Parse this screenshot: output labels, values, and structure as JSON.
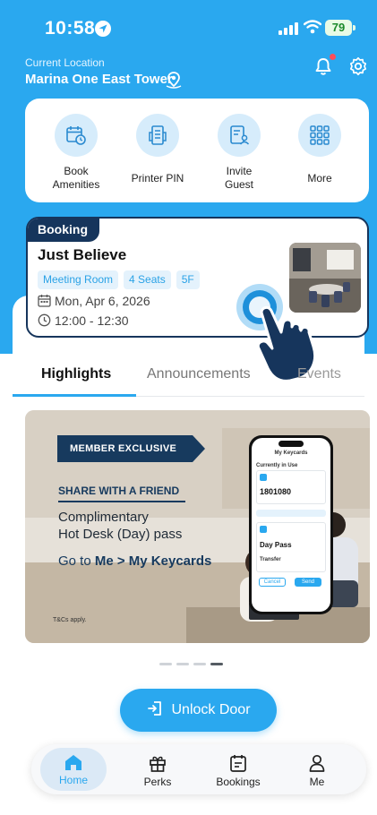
{
  "status_bar": {
    "time": "10:58",
    "battery": "79"
  },
  "header": {
    "location_label": "Current Location",
    "location_name": "Marina One East Tower"
  },
  "quick_actions": [
    {
      "label": "Book\nAmenities",
      "icon": "calendar-clock-icon"
    },
    {
      "label": "Printer PIN",
      "icon": "printer-icon"
    },
    {
      "label": "Invite\nGuest",
      "icon": "guest-badge-icon"
    },
    {
      "label": "More",
      "icon": "grid-icon"
    }
  ],
  "booking": {
    "tag": "Booking",
    "title": "Just Believe",
    "chips": [
      "Meeting Room",
      "4 Seats",
      "5F"
    ],
    "date": "Mon, Apr 6, 2026",
    "time": "12:00 - 12:30"
  },
  "tabs": {
    "highlights": "Highlights",
    "announcements": "Announcements",
    "events": "Events"
  },
  "banner": {
    "tag": "MEMBER EXCLUSIVE",
    "headline": "SHARE WITH A FRIEND",
    "line1": "Complimentary",
    "line2": "Hot Desk (Day) pass",
    "goto_prefix": "Go to ",
    "goto_path": "Me > My Keycards",
    "terms": "T&Cs apply.",
    "phone": {
      "title": "My Keycards",
      "section": "Currently in Use",
      "code": "1801080",
      "pass_title": "Day Pass",
      "transfer": "Transfer",
      "cancel": "Cancel",
      "send": "Send"
    }
  },
  "carousel": {
    "count": 4,
    "active_index": 3
  },
  "unlock_label": "Unlock Door",
  "nav": {
    "home": "Home",
    "perks": "Perks",
    "bookings": "Bookings",
    "me": "Me"
  },
  "colors": {
    "primary": "#2aa8ef",
    "navy": "#16355c",
    "chip_bg": "#e4f2fc"
  }
}
